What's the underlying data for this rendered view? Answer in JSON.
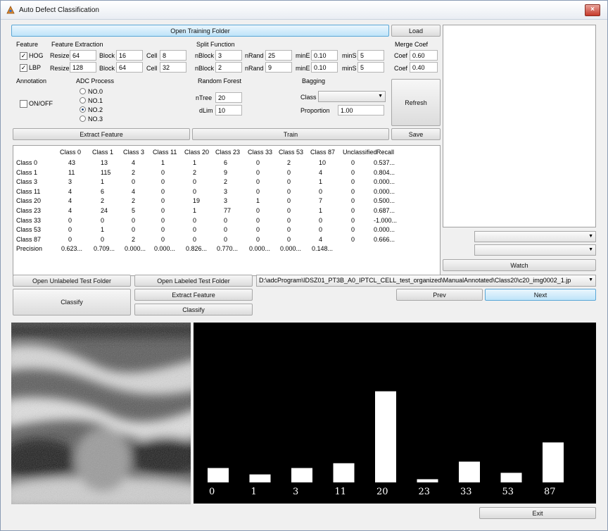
{
  "window": {
    "title": "Auto Defect Classification",
    "close_label": "×"
  },
  "buttons": {
    "open_training_folder": "Open Training Folder",
    "load": "Load",
    "refresh": "Refresh",
    "extract_feature": "Extract Feature",
    "train": "Train",
    "save": "Save",
    "watch": "Watch",
    "open_unlabeled": "Open Unlabeled Test Folder",
    "open_labeled": "Open Labeled Test Folder",
    "classify_big": "Classify",
    "extract_feature_test": "Extract Feature",
    "classify_small": "Classify",
    "prev": "Prev",
    "next": "Next",
    "exit": "Exit"
  },
  "feature": {
    "header": "Feature",
    "hog_label": "HOG",
    "hog_checked": true,
    "lbp_label": "LBP",
    "lbp_checked": true
  },
  "feature_extraction": {
    "header": "Feature Extraction",
    "resize_label": "Resize",
    "block_label": "Block",
    "cell_label": "Cell",
    "hog": {
      "resize": "64",
      "block": "16",
      "cell": "8"
    },
    "lbp": {
      "resize": "128",
      "block": "64",
      "cell": "32"
    }
  },
  "split_function": {
    "header": "Split Function",
    "nblock_label": "nBlock",
    "nrand_label": "nRand",
    "mine_label": "minE",
    "mins_label": "minS",
    "row1": {
      "nblock": "3",
      "nrand": "25",
      "mine": "0.10",
      "mins": "5"
    },
    "row2": {
      "nblock": "2",
      "nrand": "9",
      "mine": "0.10",
      "mins": "5"
    }
  },
  "merge_coef": {
    "header": "Merge Coef",
    "coef_label": "Coef",
    "coef1": "0.60",
    "coef2": "0.40"
  },
  "annotation": {
    "header": "Annotation",
    "toggle_label": "ON/OFF",
    "checked": false
  },
  "adc_process": {
    "header": "ADC Process",
    "options": [
      "NO.0",
      "NO.1",
      "NO.2",
      "NO.3"
    ],
    "selected_index": 2
  },
  "random_forest": {
    "header": "Random Forest",
    "ntree_label": "nTree",
    "ntree": "20",
    "dlim_label": "dLim",
    "dlim": "10"
  },
  "bagging": {
    "header": "Bagging",
    "class_label": "Class",
    "class_value": "",
    "proportion_label": "Proportion",
    "proportion": "1.00"
  },
  "confusion": {
    "columns": [
      "Class 0",
      "Class 1",
      "Class 3",
      "Class 11",
      "Class 20",
      "Class 23",
      "Class 33",
      "Class 53",
      "Class 87",
      "Unclassified",
      "Recall"
    ],
    "rows": [
      {
        "label": "Class 0",
        "cells": [
          "43",
          "13",
          "4",
          "1",
          "1",
          "6",
          "0",
          "2",
          "10",
          "0",
          "0.537..."
        ]
      },
      {
        "label": "Class 1",
        "cells": [
          "11",
          "115",
          "2",
          "0",
          "2",
          "9",
          "0",
          "0",
          "4",
          "0",
          "0.804..."
        ]
      },
      {
        "label": "Class 3",
        "cells": [
          "3",
          "1",
          "0",
          "0",
          "0",
          "2",
          "0",
          "0",
          "1",
          "0",
          "0.000..."
        ]
      },
      {
        "label": "Class 11",
        "cells": [
          "4",
          "6",
          "4",
          "0",
          "0",
          "3",
          "0",
          "0",
          "0",
          "0",
          "0.000..."
        ]
      },
      {
        "label": "Class 20",
        "cells": [
          "4",
          "2",
          "2",
          "0",
          "19",
          "3",
          "1",
          "0",
          "7",
          "0",
          "0.500..."
        ]
      },
      {
        "label": "Class 23",
        "cells": [
          "4",
          "24",
          "5",
          "0",
          "1",
          "77",
          "0",
          "0",
          "1",
          "0",
          "0.687..."
        ]
      },
      {
        "label": "Class 33",
        "cells": [
          "0",
          "0",
          "0",
          "0",
          "0",
          "0",
          "0",
          "0",
          "0",
          "0",
          "-1.000..."
        ]
      },
      {
        "label": "Class 53",
        "cells": [
          "0",
          "1",
          "0",
          "0",
          "0",
          "0",
          "0",
          "0",
          "0",
          "0",
          "0.000..."
        ]
      },
      {
        "label": "Class 87",
        "cells": [
          "0",
          "0",
          "2",
          "0",
          "0",
          "0",
          "0",
          "0",
          "4",
          "0",
          "0.666..."
        ]
      }
    ],
    "precision_label": "Precision",
    "precision": [
      "0.623...",
      "0.709...",
      "0.000...",
      "0.000...",
      "0.826...",
      "0.770...",
      "0.000...",
      "0.000...",
      "0.148..."
    ]
  },
  "test": {
    "path": "D:\\adcProgram\\IDSZ01_PT3B_A0_IPTCL_CELL_test_organized\\ManualAnnotated\\Class20\\c20_img0002_1.jp"
  },
  "side_combos": {
    "combo1": "",
    "combo2": ""
  },
  "chart_data": {
    "type": "bar",
    "categories": [
      "0",
      "1",
      "3",
      "11",
      "20",
      "23",
      "33",
      "53",
      "87"
    ],
    "values": [
      0.09,
      0.05,
      0.09,
      0.12,
      0.57,
      0.02,
      0.13,
      0.06,
      0.25
    ],
    "ylim": [
      0,
      1
    ],
    "bar_color": "#ffffff",
    "background": "#000000"
  }
}
